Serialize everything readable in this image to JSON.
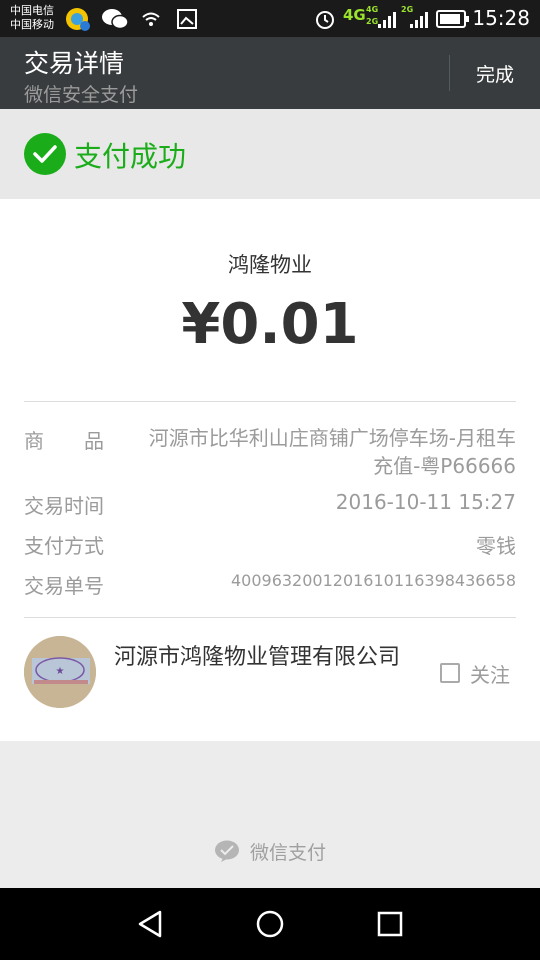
{
  "status_bar": {
    "carrier_top": "中国电信",
    "carrier_bottom": "中国移动",
    "network_type": "4G",
    "net_small_top": "4G",
    "net_small_bottom": "2G",
    "net_small_right": "2G",
    "time": "15:28"
  },
  "app_bar": {
    "title": "交易详情",
    "subtitle": "微信安全支付",
    "done_label": "完成"
  },
  "payment_status": {
    "text": "支付成功",
    "color": "#1aad19"
  },
  "receipt": {
    "merchant_name": "鸿隆物业",
    "amount": "¥0.01",
    "rows": {
      "goods": {
        "label": "商　　品",
        "value": "河源市比华利山庄商铺广场停车场-月租车充值-粤P66666"
      },
      "time": {
        "label": "交易时间",
        "value": "2016-10-11 15:27"
      },
      "method": {
        "label": "支付方式",
        "value": "零钱"
      },
      "order": {
        "label": "交易单号",
        "value": "4009632001201610116398436658"
      }
    }
  },
  "official_account": {
    "name": "河源市鸿隆物业管理有限公司",
    "follow_label": "关注",
    "followed": false
  },
  "footer": {
    "brand": "微信支付"
  },
  "icons": [
    "wechat-icon",
    "wifi-icon",
    "image-icon",
    "alarm-icon",
    "signal-icon",
    "battery-icon",
    "check-icon",
    "wechat-pay-icon",
    "back-icon",
    "home-icon",
    "recents-icon"
  ]
}
